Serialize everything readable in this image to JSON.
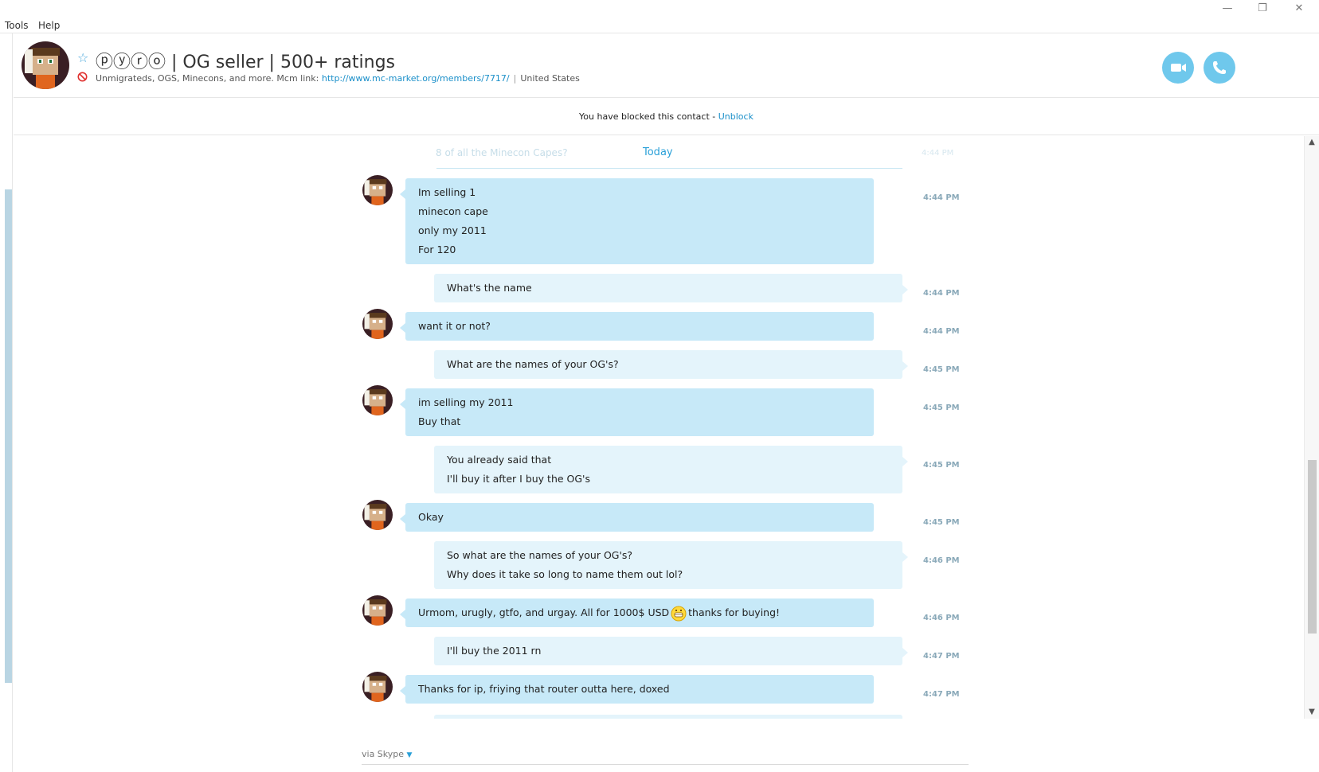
{
  "menu": {
    "tools": "Tools",
    "help": "Help"
  },
  "window_controls": {
    "minimize": "—",
    "restore": "❐",
    "close": "✕"
  },
  "contact": {
    "name": "ⓟⓨⓡⓞ | OG seller | 500+ ratings",
    "mood_text": "Unmigrateds, OGS, Minecons, and more. Mcm link: ",
    "mood_link": "http://www.mc-market.org/members/7717/",
    "separator": "|",
    "location": "United States"
  },
  "blocked_notice": {
    "text": "You have blocked this contact - ",
    "action": "Unblock"
  },
  "conversation": {
    "faded_preview": "8 of all the Minecon Capes?",
    "faded_time": "4:44 PM",
    "date_divider": "Today",
    "messages": [
      {
        "from": "them",
        "lines": [
          "Im selling 1",
          "minecon cape",
          "only my 2011",
          "For 120"
        ],
        "time": "4:44 PM"
      },
      {
        "from": "me",
        "lines": [
          "What's the name"
        ],
        "time": "4:44 PM"
      },
      {
        "from": "them",
        "lines": [
          "want it or not?"
        ],
        "time": "4:44 PM"
      },
      {
        "from": "me",
        "lines": [
          "What are the names of your OG's?"
        ],
        "time": "4:45 PM"
      },
      {
        "from": "them",
        "lines": [
          "im selling my 2011",
          "Buy that"
        ],
        "time": "4:45 PM"
      },
      {
        "from": "me",
        "lines": [
          "You already said that",
          "I'll buy it after I buy the OG's"
        ],
        "time": "4:45 PM"
      },
      {
        "from": "them",
        "lines": [
          "Okay"
        ],
        "time": "4:45 PM"
      },
      {
        "from": "me",
        "lines": [
          "So what are the names of your OG's?",
          "Why does it take so long to name them out lol?"
        ],
        "time": "4:46 PM"
      },
      {
        "from": "them",
        "text_before_emoji": "Urmom, urugly, gtfo, and urgay. All for 1000$ USD",
        "text_after_emoji": "thanks for buying!",
        "time": "4:46 PM"
      },
      {
        "from": "me",
        "lines": [
          "I'll buy the 2011 rn"
        ],
        "time": "4:47 PM"
      },
      {
        "from": "them",
        "lines": [
          "Thanks for ip, friying that router outta here, doxed"
        ],
        "time": "4:47 PM"
      }
    ]
  },
  "composer": {
    "via": "via Skype"
  },
  "colors": {
    "accent": "#2aa0d8",
    "bubble_them": "#c7e9f8",
    "bubble_me": "#e4f4fb",
    "call_button": "#6fc8ec"
  },
  "icons": [
    "favorite-star-icon",
    "blocked-icon",
    "video-call-icon",
    "audio-call-icon",
    "grin-emoji-icon"
  ]
}
